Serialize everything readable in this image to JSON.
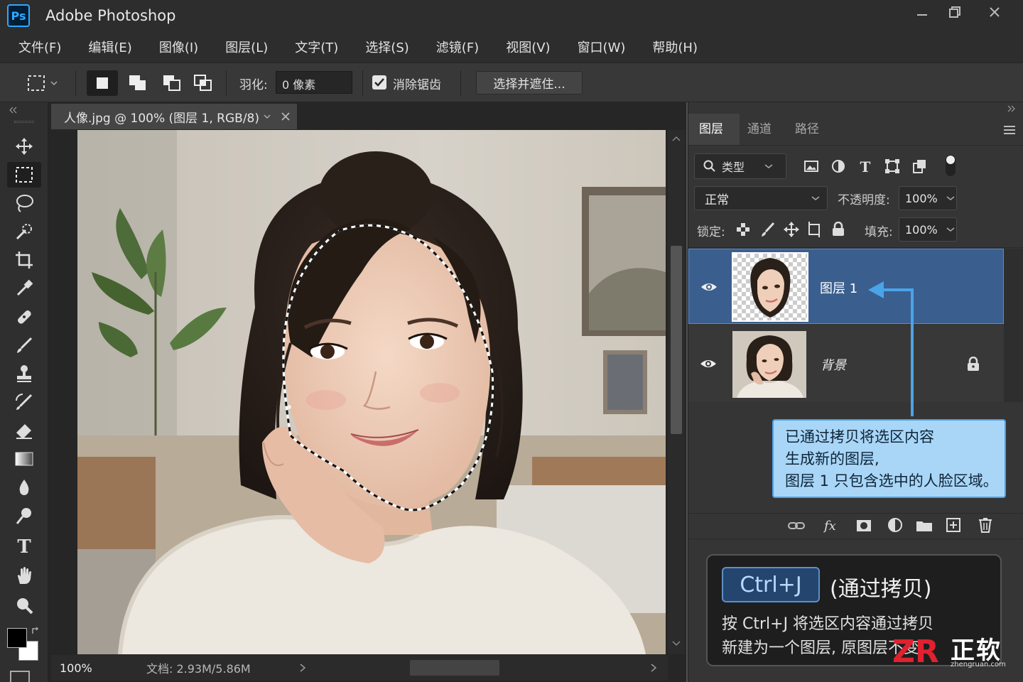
{
  "app": {
    "title": "Adobe Photoshop",
    "logo": "Ps"
  },
  "window_controls": [
    "minimize-icon",
    "restore-icon",
    "close-icon"
  ],
  "menu": [
    "文件(F)",
    "编辑(E)",
    "图像(I)",
    "图层(L)",
    "文字(T)",
    "选择(S)",
    "滤镜(F)",
    "视图(V)",
    "窗口(W)",
    "帮助(H)"
  ],
  "options": {
    "feather_label": "羽化:",
    "feather_value": "0 像素",
    "antialias_label": "消除锯齿",
    "antialias_checked": true,
    "select_mask_label": "选择并遮住..."
  },
  "document": {
    "tab_title": "人像.jpg @ 100% (图层 1, RGB/8)",
    "zoom": "100%",
    "doc_info": "文档: 2.93M/5.86M"
  },
  "tools": [
    "move-tool",
    "marquee-tool",
    "lasso-tool",
    "quick-select-tool",
    "crop-tool",
    "eyedropper-tool",
    "healing-tool",
    "brush-tool",
    "stamp-tool",
    "history-brush-tool",
    "eraser-tool",
    "gradient-tool",
    "blur-tool",
    "dodge-tool",
    "type-tool",
    "hand-tool",
    "zoom-tool"
  ],
  "layers_panel": {
    "tabs": [
      "图层",
      "通道",
      "路径"
    ],
    "active_tab": "图层",
    "filter_label": "类型",
    "blend_mode": "正常",
    "opacity_label": "不透明度:",
    "opacity_value": "100%",
    "lock_label": "锁定:",
    "fill_label": "填充:",
    "fill_value": "100%",
    "layers": [
      {
        "name": "图层 1",
        "selected": true,
        "visible": true,
        "locked": false
      },
      {
        "name": "背景",
        "selected": false,
        "visible": true,
        "locked": true
      }
    ],
    "footer_icons": [
      "link-icon",
      "fx-icon",
      "mask-icon",
      "adjustment-icon",
      "folder-icon",
      "new-layer-icon",
      "trash-icon"
    ]
  },
  "callout": {
    "lines": [
      "已通过拷贝将选区内容",
      "生成新的图层,",
      "图层 1 只包含选中的人脸区域。"
    ]
  },
  "info_box": {
    "shortcut": "Ctrl+J",
    "title": "(通过拷贝)",
    "lines": [
      "按 Ctrl+J 将选区内容通过拷贝",
      "新建为一个图层, 原图层不变"
    ]
  },
  "watermark": {
    "text": "正软",
    "sub": "zhengruan.com"
  },
  "colors": {
    "accent": "#31a8ff",
    "selected_layer": "#3a5f8f",
    "callout_bg": "#a9d6f7",
    "callout_border": "#4ba3e8"
  }
}
